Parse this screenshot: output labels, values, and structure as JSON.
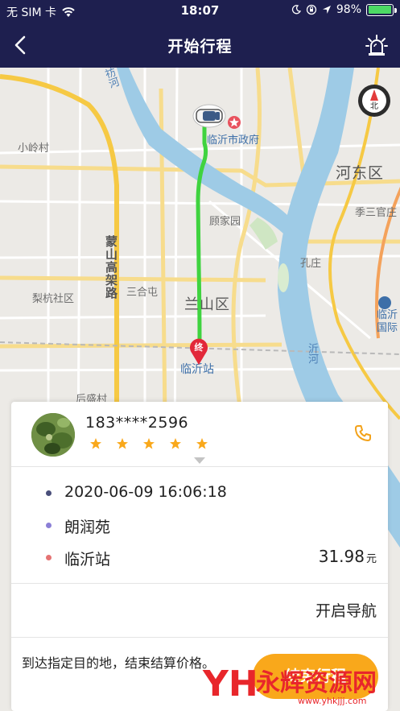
{
  "status_bar": {
    "carrier": "无 SIM 卡",
    "time": "18:07",
    "battery": "98%",
    "battery_level": 0.98,
    "icons": [
      "wifi-icon",
      "moon-icon",
      "orientation-lock-icon",
      "location-arrow-icon",
      "battery-icon"
    ]
  },
  "nav": {
    "title": "开始行程",
    "back_icon": "chevron-left-icon",
    "alarm_icon": "siren-alarm-icon"
  },
  "map": {
    "compass_label": "北",
    "labels": {
      "gov": "临沂市政府",
      "hedong": "河东区",
      "xiaoling": "小岭村",
      "gujiayuan": "顾家园",
      "jisanguan": "季三官庄",
      "mengshan_road": "蒙山高架路",
      "sanhetun": "三合屯",
      "kongzhuang": "孔庄",
      "lihangcun": "梨杭社区",
      "lanshan": "兰山区",
      "linyi_intl": "临沂国际",
      "linyi_intl_line1": "临沂",
      "linyi_intl_line2": "国际",
      "yihe": "沂河",
      "fanghe": "祊河",
      "station": "临沂站",
      "houcheng": "后盛村",
      "end_marker_text": "终"
    }
  },
  "driver": {
    "phone": "183****2596",
    "rating": 5,
    "call_icon": "phone-icon"
  },
  "trip": {
    "departure_time": "2020-06-09 16:06:18",
    "start": "朗润苑",
    "destination": "临沂站",
    "fare": "31.98",
    "fare_unit": "元",
    "dot_colors": {
      "time": "#4a4f7a",
      "start": "#8b7fd6",
      "end": "#e57373"
    }
  },
  "actions": {
    "start_navigation": "开启导航",
    "hint": "到达指定目的地，结束结算价格。",
    "end_trip": "结束行程"
  },
  "watermark": {
    "logo": "YH",
    "name": "永辉资源网",
    "url": "www.yhkjjj.com"
  },
  "colors": {
    "nav_bg": "#1e1f4f",
    "route": "#3fd33f",
    "accent": "#f9a81b",
    "river": "#9ecbe6",
    "highway": "#f6c944"
  }
}
